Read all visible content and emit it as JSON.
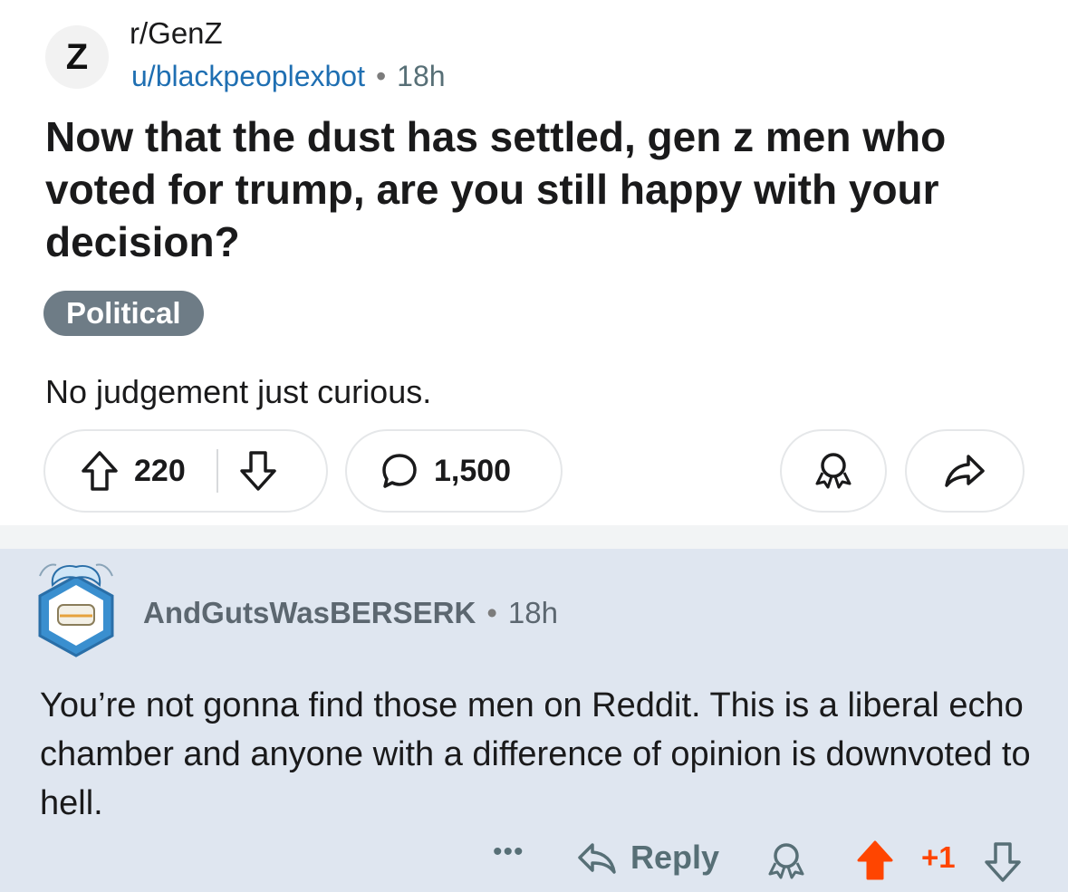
{
  "post": {
    "subreddit_initial": "Z",
    "subreddit": "r/GenZ",
    "author": "u/blackpeoplexbot",
    "separator": "•",
    "age": "18h",
    "title": "Now that the dust has settled, gen z men who voted for trump, are you still happy with your decision?",
    "flair": "Political",
    "body": "No judgement just curious.",
    "votes": "220",
    "comments": "1,500"
  },
  "comment": {
    "username": "AndGutsWasBERSERK",
    "separator": "•",
    "age": "18h",
    "text": "You’re not gonna find those men on Reddit. This is a liberal echo chamber and anyone with a difference of opinion is downvoted to hell.",
    "more": "•••",
    "reply_label": "Reply",
    "score": "+1"
  },
  "colors": {
    "author_link": "#1f6fb2",
    "flair_bg": "#6e7c86",
    "comment_bg": "#dfe6f0",
    "upvote_active": "#ff4500"
  }
}
